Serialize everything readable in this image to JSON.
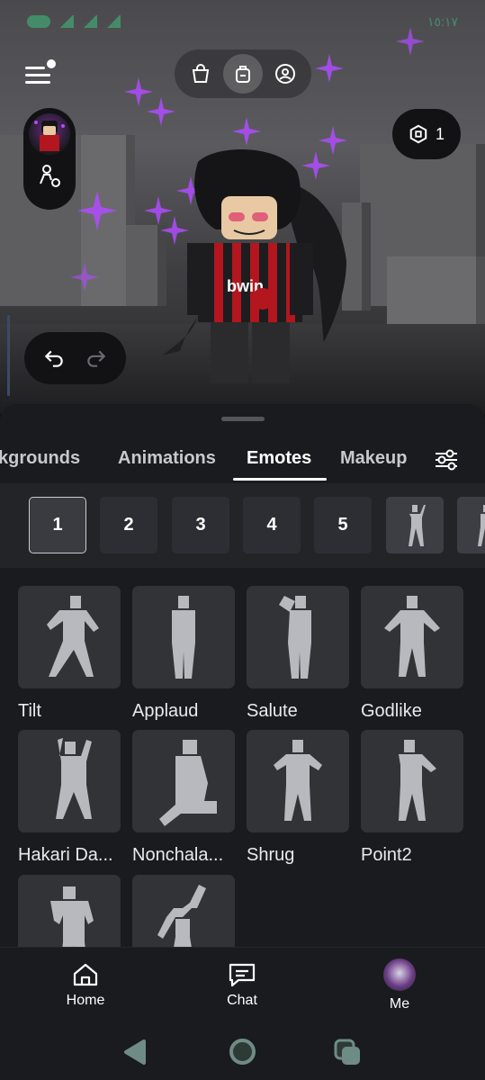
{
  "status_bar": {
    "time": "١٥:١٧"
  },
  "scene": {
    "robux_count": "1",
    "undo_icon": "undo-icon",
    "redo_icon": "redo-icon"
  },
  "top_nav": {
    "icons": [
      "shopping-bag-icon",
      "backpack-icon",
      "avatar-circle-icon"
    ],
    "active": "backpack-icon"
  },
  "tabs": {
    "items": [
      "kgrounds",
      "Animations",
      "Emotes",
      "Makeup"
    ],
    "active": "Emotes"
  },
  "emote_slots": {
    "numbers": [
      "1",
      "2",
      "3",
      "4",
      "5"
    ],
    "selected": "1"
  },
  "emotes": [
    {
      "label": "Tilt"
    },
    {
      "label": "Applaud"
    },
    {
      "label": "Salute"
    },
    {
      "label": "Godlike"
    },
    {
      "label": "Hakari Da..."
    },
    {
      "label": "Nonchala..."
    },
    {
      "label": "Shrug"
    },
    {
      "label": "Point2"
    },
    {
      "label": ""
    },
    {
      "label": ""
    }
  ],
  "bottom_nav": {
    "home": "Home",
    "chat": "Chat",
    "me": "Me"
  },
  "colors": {
    "sheet_bg": "#1a1b1e",
    "tile_bg": "#323337",
    "sparkle": "#b04bff"
  }
}
